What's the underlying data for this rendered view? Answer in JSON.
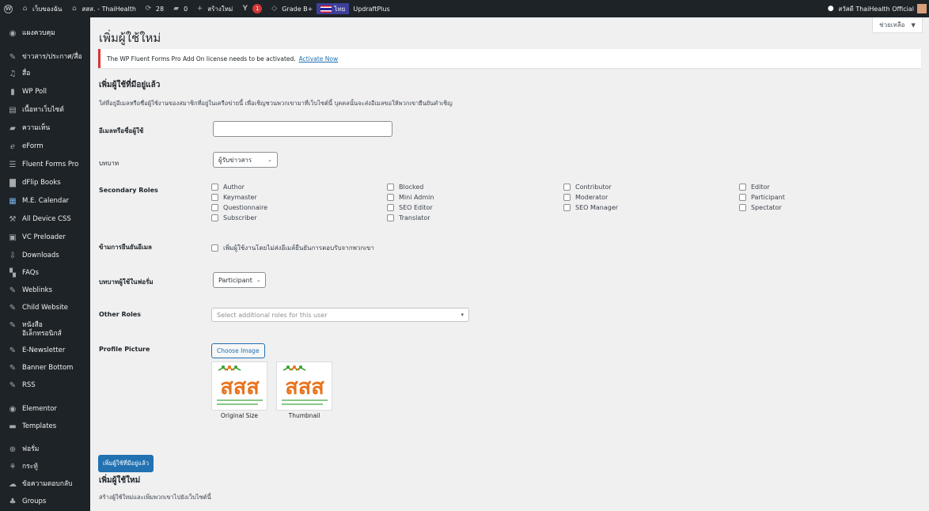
{
  "admin_bar": {
    "site_name": "เว็บของฉัน",
    "site2_name": "สสส. - ThaiHealth",
    "updates_count": "28",
    "comments_count": "0",
    "new_label": "สร้างใหม่",
    "yoast_badge": "1",
    "grade_label": "Grade B+",
    "language_label": "ไทย",
    "updraft_label": "UpdraftPlus",
    "greeting": "สวัสดี ThaiHealth Official"
  },
  "sidebar": {
    "items": [
      {
        "icon": "dashboard-icon",
        "label": "แผงควบคุม"
      },
      {
        "icon": "pin-icon",
        "label": "ข่าวสาร/ประกาศ/สื่อ"
      },
      {
        "icon": "media-icon",
        "label": "สื่อ"
      },
      {
        "icon": "poll-icon",
        "label": "WP Poll"
      },
      {
        "icon": "page-icon",
        "label": "เนื้อหาเว็บไซต์"
      },
      {
        "icon": "comment-icon",
        "label": "ความเห็น"
      },
      {
        "icon": "eform-icon",
        "label": "eForm"
      },
      {
        "icon": "fluent-forms-icon",
        "label": "Fluent Forms Pro"
      },
      {
        "icon": "book-icon",
        "label": "dFlip Books"
      },
      {
        "icon": "calendar-icon",
        "label": "M.E. Calendar"
      },
      {
        "icon": "css-icon",
        "label": "All Device CSS"
      },
      {
        "icon": "preloader-icon",
        "label": "VC Preloader"
      },
      {
        "icon": "download-icon",
        "label": "Downloads"
      },
      {
        "icon": "faq-icon",
        "label": "FAQs"
      },
      {
        "icon": "pin-icon",
        "label": "Weblinks"
      },
      {
        "icon": "pin-icon",
        "label": "Child Website"
      },
      {
        "icon": "pin-icon",
        "label": "หนังสือ\nอิเล็กทรอนิกส์"
      },
      {
        "icon": "pin-icon",
        "label": "E-Newsletter"
      },
      {
        "icon": "pin-icon",
        "label": "Banner Bottom"
      },
      {
        "icon": "pin-icon",
        "label": "RSS"
      },
      {
        "icon": "elementor-icon",
        "label": "Elementor"
      },
      {
        "icon": "templates-icon",
        "label": "Templates"
      },
      {
        "icon": "forum-icon",
        "label": "ฟอรั่ม"
      },
      {
        "icon": "topic-icon",
        "label": "กระทู้"
      },
      {
        "icon": "replies-icon",
        "label": "ข้อความตอบกลับ"
      },
      {
        "icon": "groups-icon",
        "label": "Groups"
      }
    ]
  },
  "main": {
    "help_tab": "ช่วยเหลือ",
    "page_title": "เพิ่มผู้ใช้ใหม่",
    "notice_text": "The WP Fluent Forms Pro Add On license needs to be activated.",
    "notice_link": "Activate Now",
    "existing_heading": "เพิ่มผู้ใช้ที่มีอยู่แล้ว",
    "existing_desc": "ใส่ที่อยู่อีเมลหรือชื่อผู้ใช้งานของสมาชิกที่อยู่ในเครือข่ายนี้ เพื่อเชิญชวนพวกเขามาที่เว็บไซต์นี้ บุคคลนั้นจะส่งอีเมลขอให้พวกเขายืนยันคำเชิญ",
    "email_label": "อีเมลหรือชื่อผู้ใช้",
    "email_value": "",
    "role_label": "บทบาท",
    "role_value": "ผู้รับข่าวสาร",
    "secondary_roles_label": "Secondary Roles",
    "secondary_roles": [
      [
        "Author",
        "Keymaster",
        "Questionnaire",
        "Subscriber"
      ],
      [
        "Blocked",
        "Mini Admin",
        "SEO Editor",
        "Translator"
      ],
      [
        "Contributor",
        "Moderator",
        "SEO Manager"
      ],
      [
        "Editor",
        "Participant",
        "Spectator"
      ]
    ],
    "skip_confirm_label": "ข้ามการยืนยันอีเมล",
    "skip_confirm_text": "เพิ่มผู้ใช้งานโดยไม่ส่งอีเมล์ยืนยันการตอบรับจากพวกเขา",
    "forum_role_label": "บทบาทผู้ใช้ในฟอรั่ม",
    "forum_role_value": "Participant",
    "other_roles_label": "Other Roles",
    "other_roles_placeholder": "Select additional roles for this user",
    "profile_picture_label": "Profile Picture",
    "choose_image_label": "Choose Image",
    "logo_text": "สสส",
    "original_size_caption": "Original Size",
    "thumbnail_caption": "Thumbnail",
    "submit_existing_label": "เพิ่มผู้ใช้ที่มีอยู่แล้ว",
    "new_heading": "เพิ่มผู้ใช้ใหม่",
    "new_desc": "สร้างผู้ใช้ใหม่และเพิ่มพวกเขาไปยังเว็บไซต์นี้"
  }
}
